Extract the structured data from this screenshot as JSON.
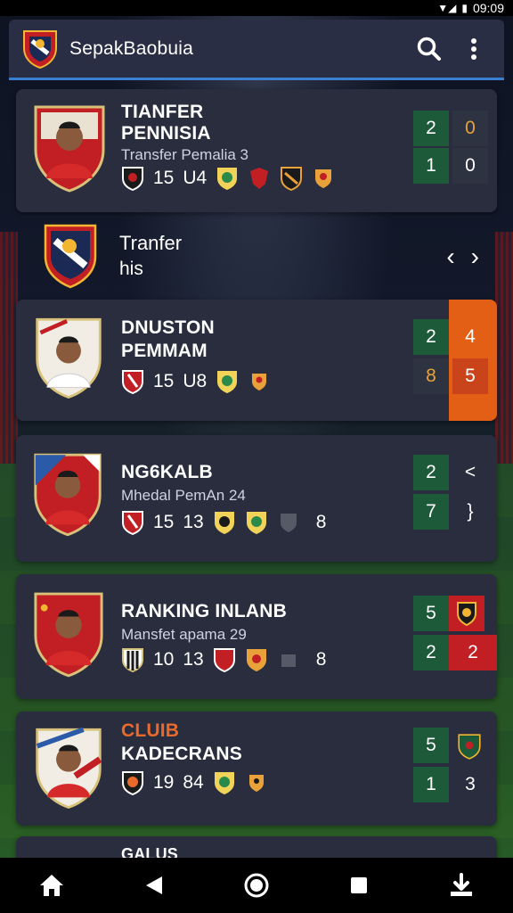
{
  "status": {
    "time": "09:09"
  },
  "appbar": {
    "title": "SepakBaobuia"
  },
  "row_plain": {
    "line1": "Tranfer",
    "line2": "his"
  },
  "cards": [
    {
      "name1": "TIANFER",
      "name2": "PENNISIA",
      "sub": "Transfer Pemalia 3",
      "stat1": "15",
      "stat2": "U4",
      "scores": [
        "2",
        "0",
        "1",
        "0"
      ]
    },
    {
      "name1": "DNUSTON",
      "name2": "PEMMAM",
      "stat1": "15",
      "stat2": "U8",
      "scores": [
        "2",
        "4",
        "8",
        "5"
      ]
    },
    {
      "name1": "NG6KALB",
      "sub": "Mhedal PemAn 24",
      "stat1": "15",
      "stat2": "13",
      "stat3": "8",
      "scores": [
        "2",
        "<",
        "7",
        "}"
      ]
    },
    {
      "name1": "RANKING INLANB",
      "sub": "Mansfet apama 29",
      "stat1": "10",
      "stat2": "13",
      "stat3": "8",
      "scores": [
        "5",
        "2",
        "2"
      ]
    },
    {
      "name1": "CLUIB",
      "name2": "KADECRANS",
      "stat1": "19",
      "stat2": "84",
      "scores": [
        "5",
        "1",
        "3"
      ]
    },
    {
      "name1": "GALUS"
    }
  ],
  "colors": {
    "accent": "#3a7fd0",
    "green": "#1d5a3a",
    "orange": "#e35f16",
    "red": "#c21f25"
  }
}
